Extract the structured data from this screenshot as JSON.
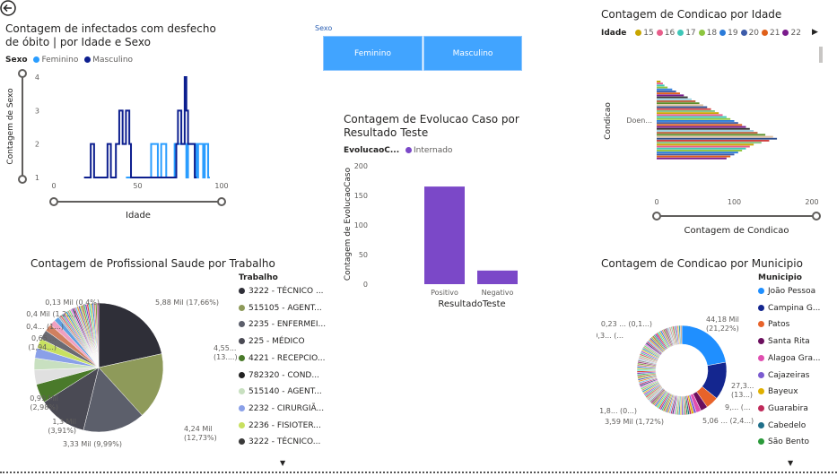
{
  "colors": {
    "feminino": "#2a9dff",
    "masculino": "#0d1f8f",
    "button": "#41a4ff",
    "bar": "#7b48c8"
  },
  "back_icon": "back-arrow-icon",
  "slicer": {
    "label": "Sexo",
    "options": [
      "Feminino",
      "Masculino"
    ]
  },
  "chart_line": {
    "title": "Contagem de infectados com desfecho de óbito | por Idade e Sexo",
    "legend_title": "Sexo",
    "legend": [
      "Feminino",
      "Masculino"
    ],
    "xlabel": "Idade",
    "ylabel": "Contagem de Sexo",
    "xticks": [
      "0",
      "50",
      "100"
    ],
    "yticks": [
      "1",
      "2",
      "3",
      "4"
    ]
  },
  "chart_bar": {
    "title": "Contagem de Evolucao Caso por Resultado Teste",
    "legend_title": "EvolucaoC...",
    "legend": [
      "Internado"
    ],
    "xlabel": "ResultadoTeste",
    "ylabel": "Contagem de EvolucaoCaso",
    "yticks": [
      "0",
      "50",
      "100",
      "150",
      "200"
    ]
  },
  "chart_hbar": {
    "title": "Contagem de Condicao por Idade",
    "legend_title": "Idade",
    "legend": [
      "15",
      "16",
      "17",
      "18",
      "19",
      "20",
      "21",
      "22"
    ],
    "legend_colors": [
      "#c8a600",
      "#e85d8a",
      "#3ec7b8",
      "#8dc63f",
      "#2b7bd9",
      "#3c5ba9",
      "#e0601a",
      "#7a1b8c"
    ],
    "ylabel": "Condicao",
    "xlabel": "Contagem de Condicao",
    "category": "Doen...",
    "xticks": [
      "0",
      "100",
      "200"
    ]
  },
  "chart_pie": {
    "title": "Contagem de Profissional Saude por Trabalho",
    "legend_title": "Trabalho",
    "legend": [
      "3222 - TÉCNICO ...",
      "515105 - AGENT...",
      "2235 - ENFERMEI...",
      "225 - MÉDICO",
      "4221 - RECEPCIO...",
      "782320 - COND...",
      "515140 - AGENT...",
      "2232 - CIRURGIÃ...",
      "2236 - FISIOTER...",
      "3222 - TÉCNICO..."
    ],
    "legend_colors": [
      "#2f2f38",
      "#8e9a5a",
      "#5c5f6b",
      "#4a4a54",
      "#4a7a2a",
      "#222222",
      "#c8e0c0",
      "#8aa0e8",
      "#c8e060",
      "#3a3a3a"
    ],
    "labels": [
      "5,88 Mil (17,66%)",
      "4,55... (13....)",
      "4,24 Mil (12,73%)",
      "3,33 Mil (9,99%)",
      "1,3 Mil (3,91%)",
      "0,99 Mil (2,98%)",
      "0,65 ... (1,94...)",
      "0,4... (1...)",
      "0,4 Mil (1,2...)",
      "0,13 Mil (0,4%)"
    ]
  },
  "chart_donut": {
    "title": "Contagem de Condicao por Municipio",
    "legend_title": "Municipio",
    "legend": [
      "João Pessoa",
      "Campina G...",
      "Patos",
      "Santa Rita",
      "Alagoa Gra...",
      "Cajazeiras",
      "Bayeux",
      "Guarabira",
      "Cabedelo",
      "São Bento"
    ],
    "legend_colors": [
      "#1f8fff",
      "#14268f",
      "#e8632a",
      "#6b0f5e",
      "#e04fb0",
      "#7b5bd0",
      "#e0b000",
      "#c02a5a",
      "#1f6f8a",
      "#2a9a3a"
    ],
    "labels": [
      "44,18 Mil (21,22%)",
      "27,3... (13...)",
      "9,... (...",
      "5,06 ... (2,4...)",
      "3,59 Mil (1,72%)",
      "1,8... (0...)",
      "0,23 ... (0,1...)",
      "0,3... (..."
    ]
  },
  "chart_data": [
    {
      "type": "line",
      "title": "Contagem de infectados com desfecho de óbito | por Idade e Sexo",
      "xlabel": "Idade",
      "ylabel": "Contagem de Sexo",
      "xlim": [
        0,
        100
      ],
      "ylim": [
        1,
        4
      ],
      "series": [
        {
          "name": "Feminino",
          "x": [
            43,
            44,
            45,
            46,
            47,
            48,
            49,
            50,
            51,
            52,
            53,
            54,
            55,
            56,
            57,
            58,
            59,
            60,
            61,
            62,
            63,
            64,
            65,
            66,
            67,
            68,
            69,
            70,
            71,
            72,
            73,
            74,
            75,
            76,
            77,
            78,
            79,
            80,
            81,
            82,
            83,
            84,
            85,
            86,
            87,
            88,
            89,
            90,
            91,
            92,
            93
          ],
          "values": [
            1,
            1,
            1,
            1,
            1,
            1,
            1,
            1,
            1,
            1,
            1,
            1,
            1,
            1,
            1,
            2,
            2,
            2,
            2,
            1,
            1,
            2,
            2,
            2,
            1,
            1,
            1,
            1,
            1,
            2,
            2,
            2,
            2,
            2,
            2,
            2,
            1,
            2,
            2,
            2,
            2,
            2,
            1,
            2,
            2,
            2,
            1,
            2,
            2,
            1,
            1
          ]
        },
        {
          "name": "Masculino",
          "x": [
            18,
            20,
            21,
            22,
            23,
            24,
            25,
            26,
            27,
            28,
            29,
            30,
            31,
            32,
            33,
            34,
            35,
            36,
            37,
            38,
            39,
            40,
            41,
            42,
            43,
            44,
            45,
            46,
            47,
            48,
            49,
            50,
            51,
            52,
            53,
            54,
            55,
            56,
            57,
            58,
            59,
            60,
            61,
            62,
            63,
            64,
            65,
            66,
            67,
            68,
            69,
            70,
            71,
            72,
            73,
            74,
            75,
            76,
            77,
            78,
            79,
            80,
            81,
            82,
            83,
            84,
            85
          ],
          "values": [
            1,
            1,
            1,
            2,
            2,
            1,
            1,
            1,
            1,
            1,
            1,
            1,
            1,
            2,
            2,
            1,
            1,
            1,
            2,
            2,
            3,
            3,
            2,
            2,
            3,
            3,
            2,
            1,
            1,
            1,
            1,
            1,
            1,
            1,
            1,
            1,
            1,
            1,
            1,
            1,
            1,
            1,
            1,
            1,
            1,
            1,
            1,
            1,
            1,
            1,
            1,
            1,
            1,
            1,
            2,
            3,
            3,
            2,
            2,
            4,
            3,
            2,
            2,
            2,
            2,
            1,
            1
          ]
        }
      ]
    },
    {
      "type": "bar",
      "title": "Contagem de Evolucao Caso por Resultado Teste",
      "categories": [
        "Positivo",
        "Negativo"
      ],
      "series": [
        {
          "name": "Internado",
          "values": [
            165,
            23
          ]
        }
      ],
      "ylim": [
        0,
        200
      ],
      "xlabel": "ResultadoTeste",
      "ylabel": "Contagem de EvolucaoCaso"
    },
    {
      "type": "bar",
      "orientation": "horizontal",
      "title": "Contagem de Condicao por Idade",
      "categories": [
        "Doen..."
      ],
      "xlim": [
        0,
        200
      ],
      "xlabel": "Contagem de Condicao",
      "ylabel": "Condicao",
      "values": [
        5,
        8,
        10,
        14,
        20,
        25,
        30,
        35,
        40,
        45,
        50,
        55,
        60,
        65,
        70,
        75,
        80,
        85,
        90,
        95,
        100,
        105,
        110,
        115,
        120,
        125,
        130,
        140,
        150,
        155,
        145,
        135,
        125,
        120,
        115,
        110,
        105,
        100,
        95,
        90
      ]
    },
    {
      "type": "pie",
      "title": "Contagem de Profissional Saude por Trabalho",
      "categories": [
        "3222 - TÉCNICO ...",
        "515105 - AGENT...",
        "2235 - ENFERMEI...",
        "225 - MÉDICO",
        "4221 - RECEPCIO...",
        "782320 - COND...",
        "515140 - AGENT...",
        "2232 - CIRURGIÃ...",
        "2236 - FISIOTER...",
        "3222 - TÉCNICO..."
      ],
      "values": [
        17.66,
        13.67,
        12.73,
        9.99,
        3.91,
        2.98,
        2.4,
        2.1,
        2.0,
        1.94,
        1.5,
        1.2,
        1.0,
        0.4
      ]
    },
    {
      "type": "pie",
      "variant": "donut",
      "title": "Contagem de Condicao por Municipio",
      "categories": [
        "João Pessoa",
        "Campina G...",
        "Patos",
        "Santa Rita",
        "Alagoa Gra...",
        "Cajazeiras",
        "Bayeux",
        "Guarabira",
        "Cabedelo",
        "São Bento"
      ],
      "values": [
        21.22,
        13.1,
        4.4,
        2.43,
        1.72,
        0.9,
        0.8,
        0.7,
        0.6,
        0.5
      ]
    }
  ]
}
